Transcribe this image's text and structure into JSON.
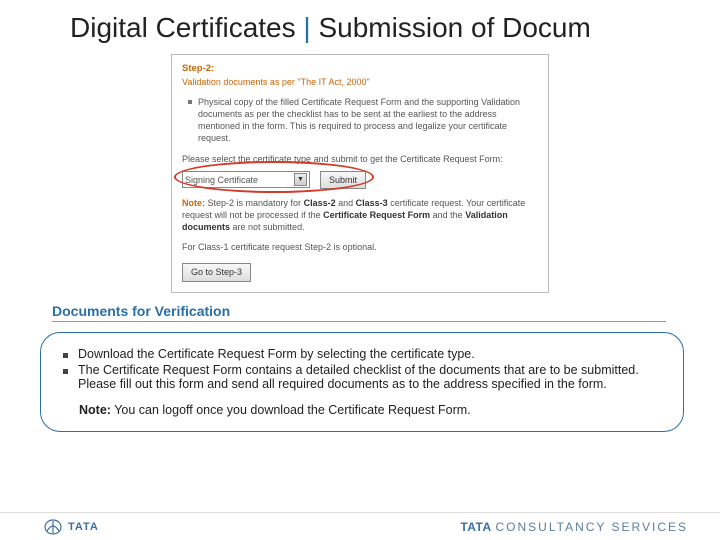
{
  "title": {
    "left": "Digital Certificates",
    "bar": "|",
    "right": "Submission of Docum"
  },
  "screenshot": {
    "step_label": "Step-2:",
    "step_sub": "Validation documents as per \"The IT Act, 2000\"",
    "bullet": "Physical copy of the filled Certificate Request Form and the supporting Validation documents as per the checklist has to be sent at the earliest to the address mentioned in the form. This is required to process and legalize your certificate request.",
    "instruction": "Please select the certificate type and submit to get the Certificate Request Form:",
    "select_value": "Signing Certificate",
    "submit_label": "Submit",
    "note_label": "Note:",
    "note_text_1": "Step-2 is mandatory for",
    "note_b1": "Class-2",
    "note_and": "and",
    "note_b2": "Class-3",
    "note_text_2": "certificate request. Your certificate request will not be processed if the",
    "note_b3": "Certificate Request Form",
    "note_text_3": "and the",
    "note_b4": "Validation documents",
    "note_text_4": "are not submitted.",
    "class1_text": "For Class-1 certificate request Step-2 is optional.",
    "goto_label": "Go to Step-3"
  },
  "section_header": "Documents for Verification",
  "info": {
    "bullet1": "Download the Certificate Request Form by selecting the certificate type.",
    "bullet2": "The Certificate Request Form contains a detailed checklist of the documents that are to be submitted. Please fill out this form and send all required documents as to the address specified in the form.",
    "note_label": "Note:",
    "note_text": "You can logoff once you download the Certificate Request Form."
  },
  "footer": {
    "tata": "TATA",
    "tcs_bold": "TATA",
    "tcs_light": "CONSULTANCY SERVICES"
  }
}
